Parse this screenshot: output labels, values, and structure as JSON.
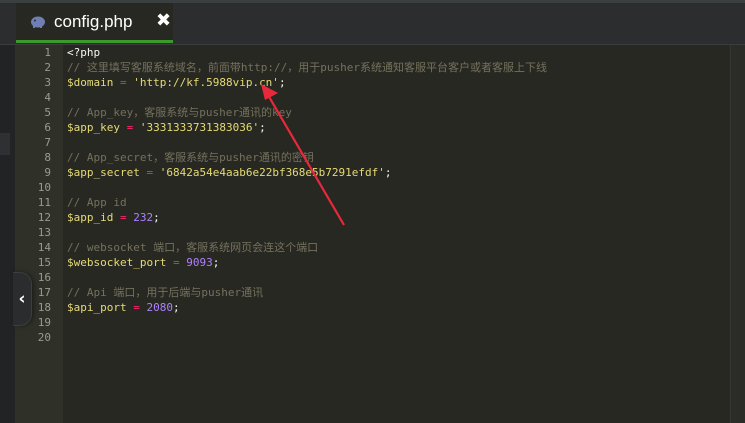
{
  "tab": {
    "filename": "config.php",
    "close_icon": "✖"
  },
  "collapse_icon": "‹",
  "lines": [
    {
      "n": "1",
      "parts": [
        {
          "t": "<?php",
          "c": "c-tag"
        }
      ]
    },
    {
      "n": "2",
      "parts": [
        {
          "t": "// 这里填写客服系统域名，前面带http://，用于pusher系统通知客服平台客户或者客服上下线",
          "c": "c-cm"
        }
      ]
    },
    {
      "n": "3",
      "parts": [
        {
          "t": "$domain",
          "c": "c-var"
        },
        {
          "t": " = ",
          "c": "c-op"
        },
        {
          "t": "'http://kf.5988vip.cn'",
          "c": "c-str"
        },
        {
          "t": ";",
          "c": "c-pn"
        }
      ]
    },
    {
      "n": "4",
      "parts": []
    },
    {
      "n": "5",
      "parts": [
        {
          "t": "// App_key，客服系统与pusher通讯的key",
          "c": "c-cm"
        }
      ]
    },
    {
      "n": "6",
      "parts": [
        {
          "t": "$app_key",
          "c": "c-var"
        },
        {
          "t": " = ",
          "c": "c-op"
        },
        {
          "t": "'3331333731383036'",
          "c": "c-str"
        },
        {
          "t": ";",
          "c": "c-pn"
        }
      ]
    },
    {
      "n": "7",
      "parts": []
    },
    {
      "n": "8",
      "parts": [
        {
          "t": "// App_secret，客服系统与pusher通讯的密钥",
          "c": "c-cm"
        }
      ]
    },
    {
      "n": "9",
      "parts": [
        {
          "t": "$app_secret",
          "c": "c-var"
        },
        {
          "t": " = ",
          "c": "c-op"
        },
        {
          "t": "'6842a54e4aab6e22bf368e5b7291efdf'",
          "c": "c-str"
        },
        {
          "t": ";",
          "c": "c-pn"
        }
      ]
    },
    {
      "n": "10",
      "parts": []
    },
    {
      "n": "11",
      "parts": [
        {
          "t": "// App id",
          "c": "c-cm"
        }
      ]
    },
    {
      "n": "12",
      "parts": [
        {
          "t": "$app_id",
          "c": "c-var"
        },
        {
          "t": " = ",
          "c": "c-op"
        },
        {
          "t": "232",
          "c": "c-num"
        },
        {
          "t": ";",
          "c": "c-pn"
        }
      ]
    },
    {
      "n": "13",
      "parts": []
    },
    {
      "n": "14",
      "parts": [
        {
          "t": "// websocket 端口，客服系统网页会连这个端口",
          "c": "c-cm"
        }
      ]
    },
    {
      "n": "15",
      "parts": [
        {
          "t": "$websocket_port",
          "c": "c-var"
        },
        {
          "t": " = ",
          "c": "c-op"
        },
        {
          "t": "9093",
          "c": "c-num"
        },
        {
          "t": ";",
          "c": "c-pn"
        }
      ]
    },
    {
      "n": "16",
      "parts": []
    },
    {
      "n": "17",
      "parts": [
        {
          "t": "// Api 端口，用于后端与pusher通讯",
          "c": "c-cm"
        }
      ]
    },
    {
      "n": "18",
      "parts": [
        {
          "t": "$api_port",
          "c": "c-var"
        },
        {
          "t": " = ",
          "c": "c-op"
        },
        {
          "t": "2080",
          "c": "c-num"
        },
        {
          "t": ";",
          "c": "c-pn"
        }
      ]
    },
    {
      "n": "19",
      "parts": []
    },
    {
      "n": "20",
      "parts": []
    }
  ],
  "colors": {
    "accent": "#3c9a2c",
    "annotation_arrow": "#e8293b",
    "editor_bg": "#272822"
  }
}
